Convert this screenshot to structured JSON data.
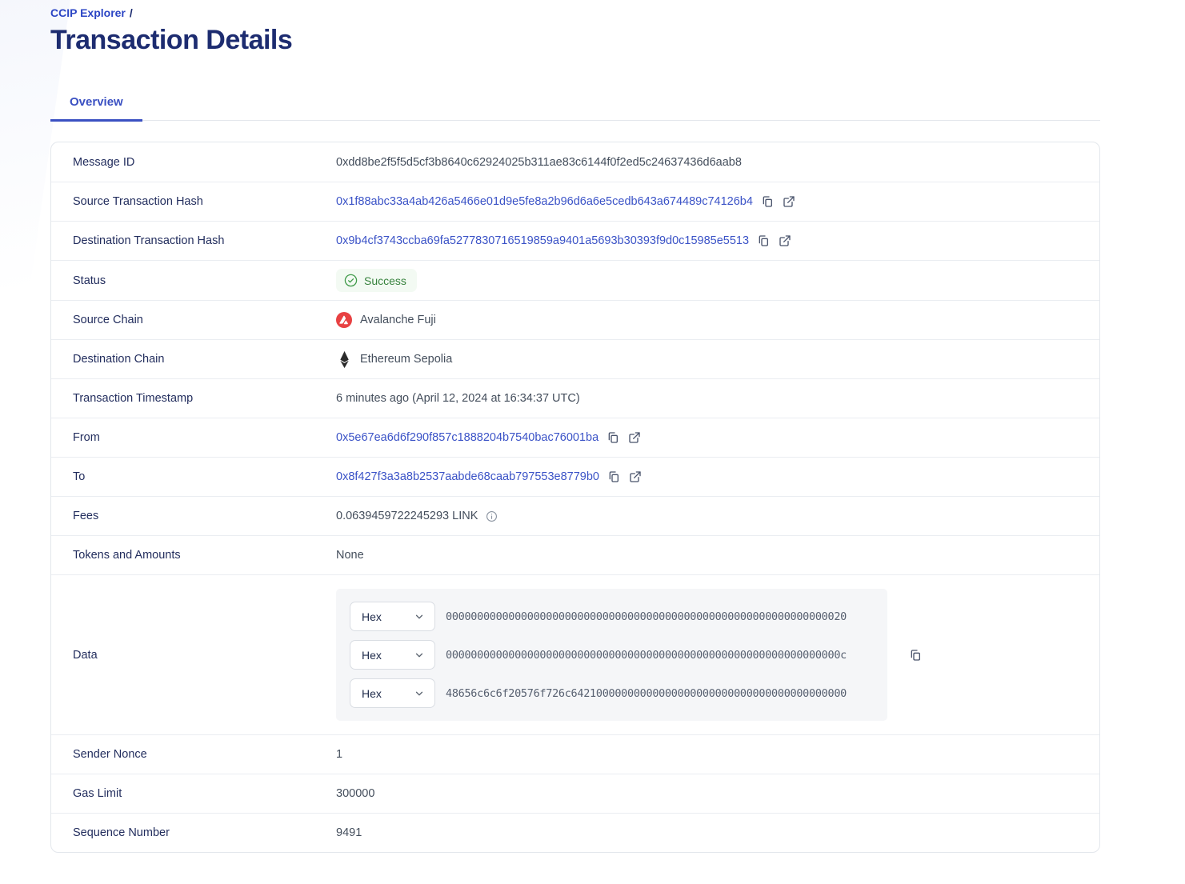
{
  "colors": {
    "accent_blue": "#3a50c2",
    "link_blue": "#3b53c7",
    "title_navy": "#1d2c70",
    "label_navy": "#232e5e",
    "success_green": "#37823d",
    "success_bg": "#f3faf3",
    "avalanche_red": "#e84142",
    "ethereum_black": "#2b2b2b",
    "panel_gray": "#f5f6f8"
  },
  "breadcrumb": {
    "link_label": "CCIP Explorer",
    "separator": "/"
  },
  "header": {
    "title": "Transaction Details"
  },
  "tabs": {
    "overview_label": "Overview"
  },
  "fields": {
    "message_id": {
      "label": "Message ID",
      "value": "0xdd8be2f5f5d5cf3b8640c62924025b311ae83c6144f0f2ed5c24637436d6aab8"
    },
    "source_tx_hash": {
      "label": "Source Transaction Hash",
      "value": "0x1f88abc33a4ab426a5466e01d9e5fe8a2b96d6a6e5cedb643a674489c74126b4"
    },
    "dest_tx_hash": {
      "label": "Destination Transaction Hash",
      "value": "0x9b4cf3743ccba69fa5277830716519859a9401a5693b30393f9d0c15985e5513"
    },
    "status": {
      "label": "Status",
      "value": "Success"
    },
    "source_chain": {
      "label": "Source Chain",
      "value": "Avalanche Fuji"
    },
    "dest_chain": {
      "label": "Destination Chain",
      "value": "Ethereum Sepolia"
    },
    "timestamp": {
      "label": "Transaction Timestamp",
      "value": "6 minutes ago (April 12, 2024 at 16:34:37 UTC)"
    },
    "from": {
      "label": "From",
      "value": "0x5e67ea6d6f290f857c1888204b7540bac76001ba"
    },
    "to": {
      "label": "To",
      "value": "0x8f427f3a3a8b2537aabde68caab797553e8779b0"
    },
    "fees": {
      "label": "Fees",
      "value": "0.0639459722245293 LINK"
    },
    "tokens_and_amounts": {
      "label": "Tokens and Amounts",
      "value": "None"
    },
    "data": {
      "label": "Data",
      "encoding_selected": "Hex",
      "lines": [
        "0000000000000000000000000000000000000000000000000000000000000020",
        "000000000000000000000000000000000000000000000000000000000000000c",
        "48656c6c6f20576f726c64210000000000000000000000000000000000000000"
      ]
    },
    "sender_nonce": {
      "label": "Sender Nonce",
      "value": "1"
    },
    "gas_limit": {
      "label": "Gas Limit",
      "value": "300000"
    },
    "sequence_number": {
      "label": "Sequence Number",
      "value": "9491"
    }
  }
}
